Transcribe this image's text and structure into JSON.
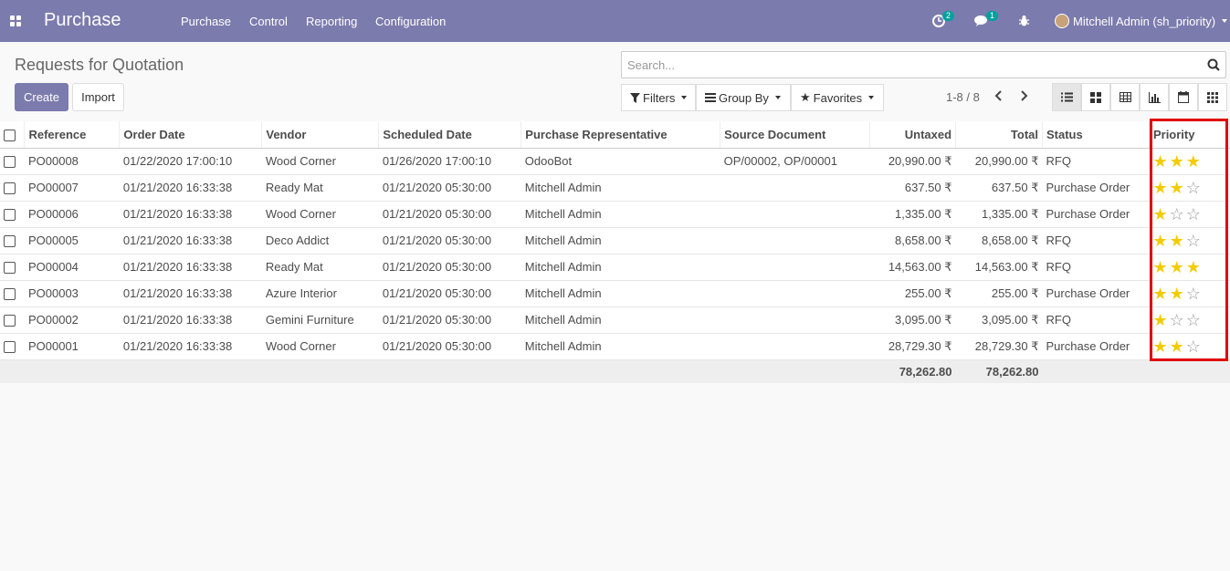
{
  "navbar": {
    "app_title": "Purchase",
    "menu": [
      "Purchase",
      "Control",
      "Reporting",
      "Configuration"
    ],
    "activity_count": "2",
    "message_count": "1",
    "user_name": "Mitchell Admin (sh_priority)"
  },
  "control_panel": {
    "title": "Requests for Quotation",
    "create_label": "Create",
    "import_label": "Import",
    "search_placeholder": "Search...",
    "filters_label": "Filters",
    "group_by_label": "Group By",
    "favorites_label": "Favorites",
    "pager": "1-8 / 8"
  },
  "table": {
    "headers": [
      "Reference",
      "Order Date",
      "Vendor",
      "Scheduled Date",
      "Purchase Representative",
      "Source Document",
      "Untaxed",
      "Total",
      "Status",
      "Priority"
    ],
    "rows": [
      {
        "ref": "PO00008",
        "order_date": "01/22/2020 17:00:10",
        "vendor": "Wood Corner",
        "scheduled": "01/26/2020 17:00:10",
        "rep": "OdooBot",
        "source": "OP/00002, OP/00001",
        "untaxed": "20,990.00 ₹",
        "total": "20,990.00 ₹",
        "status": "RFQ",
        "priority": 3
      },
      {
        "ref": "PO00007",
        "order_date": "01/21/2020 16:33:38",
        "vendor": "Ready Mat",
        "scheduled": "01/21/2020 05:30:00",
        "rep": "Mitchell Admin",
        "source": "",
        "untaxed": "637.50 ₹",
        "total": "637.50 ₹",
        "status": "Purchase Order",
        "priority": 2
      },
      {
        "ref": "PO00006",
        "order_date": "01/21/2020 16:33:38",
        "vendor": "Wood Corner",
        "scheduled": "01/21/2020 05:30:00",
        "rep": "Mitchell Admin",
        "source": "",
        "untaxed": "1,335.00 ₹",
        "total": "1,335.00 ₹",
        "status": "Purchase Order",
        "priority": 1
      },
      {
        "ref": "PO00005",
        "order_date": "01/21/2020 16:33:38",
        "vendor": "Deco Addict",
        "scheduled": "01/21/2020 05:30:00",
        "rep": "Mitchell Admin",
        "source": "",
        "untaxed": "8,658.00 ₹",
        "total": "8,658.00 ₹",
        "status": "RFQ",
        "priority": 2
      },
      {
        "ref": "PO00004",
        "order_date": "01/21/2020 16:33:38",
        "vendor": "Ready Mat",
        "scheduled": "01/21/2020 05:30:00",
        "rep": "Mitchell Admin",
        "source": "",
        "untaxed": "14,563.00 ₹",
        "total": "14,563.00 ₹",
        "status": "RFQ",
        "priority": 3
      },
      {
        "ref": "PO00003",
        "order_date": "01/21/2020 16:33:38",
        "vendor": "Azure Interior",
        "scheduled": "01/21/2020 05:30:00",
        "rep": "Mitchell Admin",
        "source": "",
        "untaxed": "255.00 ₹",
        "total": "255.00 ₹",
        "status": "Purchase Order",
        "priority": 2
      },
      {
        "ref": "PO00002",
        "order_date": "01/21/2020 16:33:38",
        "vendor": "Gemini Furniture",
        "scheduled": "01/21/2020 05:30:00",
        "rep": "Mitchell Admin",
        "source": "",
        "untaxed": "3,095.00 ₹",
        "total": "3,095.00 ₹",
        "status": "RFQ",
        "priority": 1
      },
      {
        "ref": "PO00001",
        "order_date": "01/21/2020 16:33:38",
        "vendor": "Wood Corner",
        "scheduled": "01/21/2020 05:30:00",
        "rep": "Mitchell Admin",
        "source": "",
        "untaxed": "28,729.30 ₹",
        "total": "28,729.30 ₹",
        "status": "Purchase Order",
        "priority": 2
      }
    ],
    "footer": {
      "untaxed": "78,262.80",
      "total": "78,262.80"
    }
  },
  "colors": {
    "brand": "#7c7bad",
    "star": "#f3cc00",
    "highlight": "#e00000"
  }
}
